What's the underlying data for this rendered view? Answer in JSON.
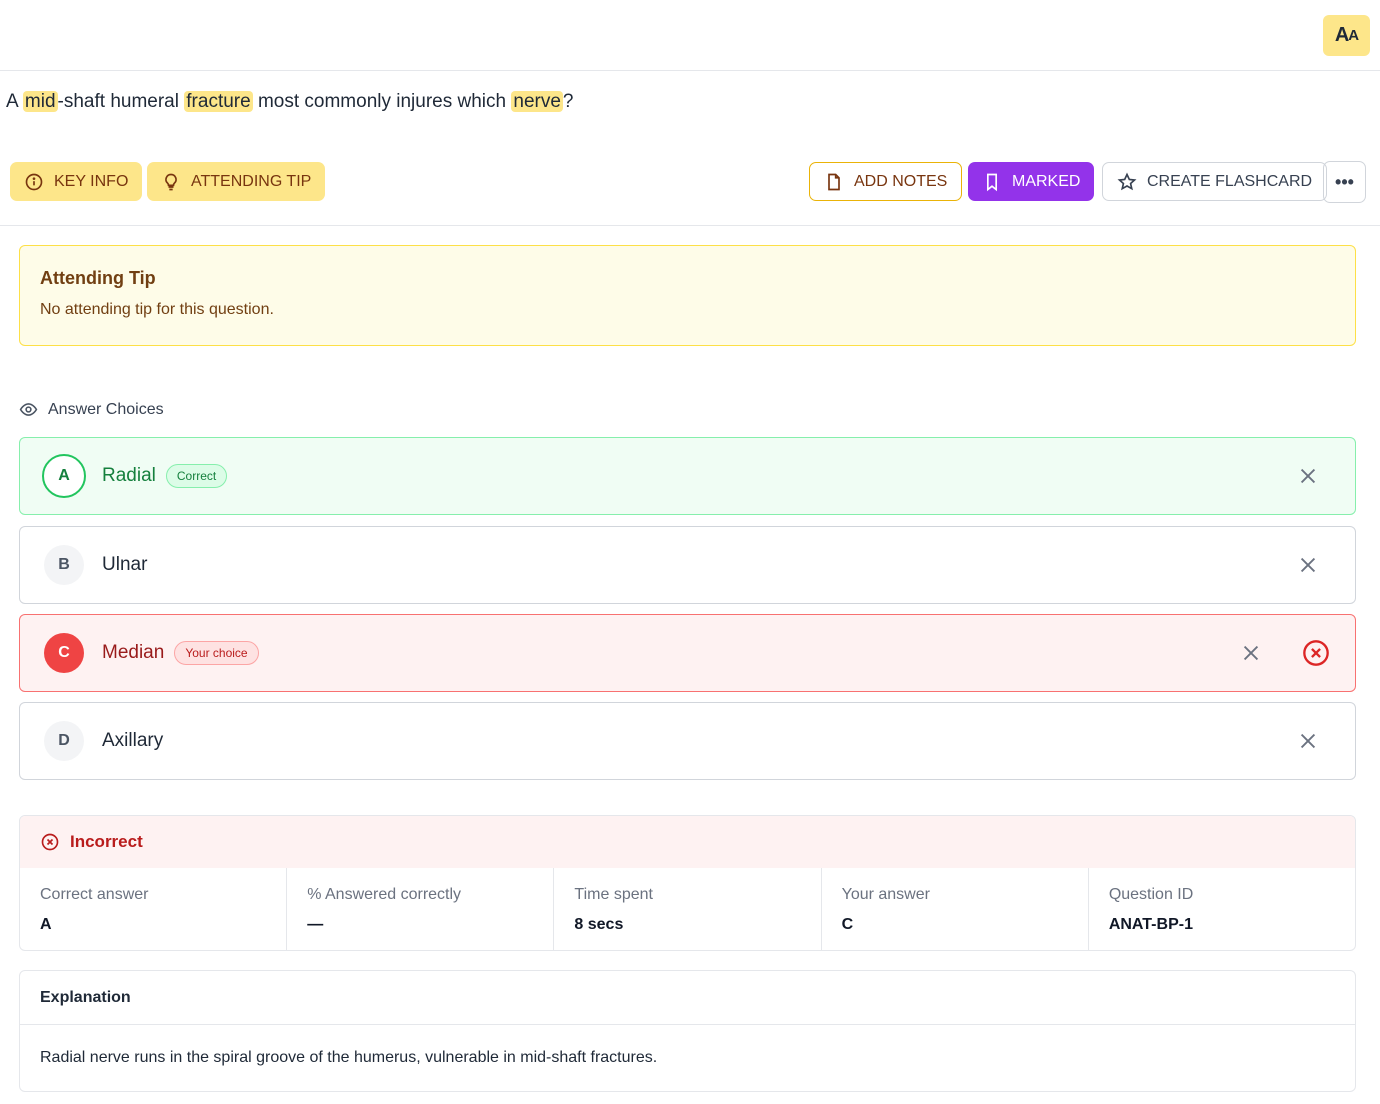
{
  "header": {
    "font_toggle_big": "A",
    "font_toggle_small": "A"
  },
  "question": {
    "parts": [
      "A ",
      "mid",
      "-shaft humeral ",
      "fracture",
      " most commonly injures which ",
      "nerve",
      "?"
    ]
  },
  "toolbar": {
    "key_info": "KEY INFO",
    "attending_tip": "ATTENDING TIP",
    "add_notes": "ADD NOTES",
    "marked": "MARKED",
    "create_flashcard": "CREATE FLASHCARD",
    "more": "•••"
  },
  "tip": {
    "title": "Attending Tip",
    "text": "No attending tip for this question."
  },
  "answer_choices": {
    "label": "Answer Choices",
    "items": [
      {
        "letter": "A",
        "text": "Radial",
        "badge": "Correct"
      },
      {
        "letter": "B",
        "text": "Ulnar"
      },
      {
        "letter": "C",
        "text": "Median",
        "badge": "Your choice"
      },
      {
        "letter": "D",
        "text": "Axillary"
      }
    ]
  },
  "result": {
    "status": "Incorrect",
    "stats": [
      {
        "label": "Correct answer",
        "value": "A"
      },
      {
        "label": "% Answered correctly",
        "value": "—"
      },
      {
        "label": "Time spent",
        "value": "8 secs"
      },
      {
        "label": "Your answer",
        "value": "C"
      },
      {
        "label": "Question ID",
        "value": "ANAT-BP-1"
      }
    ]
  },
  "explanation": {
    "title": "Explanation",
    "text": "Radial nerve runs in the spiral groove of the humerus, vulnerable in mid-shaft fractures."
  },
  "colors": {
    "highlight": "#fde68a",
    "marked": "#9333ea",
    "correct": "#22c55e",
    "wrong": "#ef4444"
  }
}
